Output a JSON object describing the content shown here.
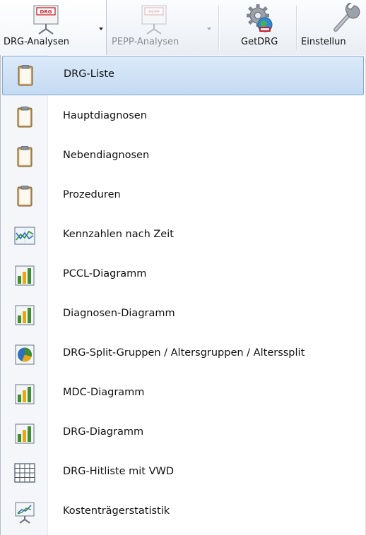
{
  "toolbar": {
    "buttons": [
      {
        "id": "drg_analysen",
        "label": "DRG-Analysen",
        "icon": "drg-presentation-icon",
        "badge": "DRG",
        "state": "active",
        "has_dropdown": true
      },
      {
        "id": "pepp_analysen",
        "label": "PEPP-Analysen",
        "icon": "pepp-presentation-icon",
        "badge": "PEPP",
        "state": "disabled",
        "has_dropdown": true
      },
      {
        "id": "getdrg",
        "label": "GetDRG",
        "icon": "gear-globe-icon",
        "state": "normal",
        "has_dropdown": false
      },
      {
        "id": "einstellungen",
        "label": "Einstellun",
        "icon": "wrench-icon",
        "state": "normal",
        "has_dropdown": false
      }
    ]
  },
  "menu": {
    "items": [
      {
        "label": "DRG-Liste",
        "icon": "clipboard-icon",
        "highlighted": true
      },
      {
        "label": "Hauptdiagnosen",
        "icon": "clipboard-icon"
      },
      {
        "label": "Nebendiagnosen",
        "icon": "clipboard-icon"
      },
      {
        "label": "Prozeduren",
        "icon": "clipboard-icon"
      },
      {
        "label": "Kennzahlen nach Zeit",
        "icon": "line-chart-icon"
      },
      {
        "label": "PCCL-Diagramm",
        "icon": "bar-chart-icon"
      },
      {
        "label": "Diagnosen-Diagramm",
        "icon": "bar-chart-icon"
      },
      {
        "label": "DRG-Split-Gruppen / Altersgruppen / Alterssplit",
        "icon": "pie-chart-icon"
      },
      {
        "label": "MDC-Diagramm",
        "icon": "bar-chart-icon"
      },
      {
        "label": "DRG-Diagramm",
        "icon": "bar-chart-icon"
      },
      {
        "label": "DRG-Hitliste mit VWD",
        "icon": "grid-table-icon"
      },
      {
        "label": "Kostenträgerstatistik",
        "icon": "presentation-chart-icon"
      }
    ]
  },
  "colors": {
    "highlight_bg": "#c4daf3",
    "highlight_border": "#85a9d6",
    "badge_red": "#c8202a",
    "disabled_text": "#8a8f96"
  }
}
